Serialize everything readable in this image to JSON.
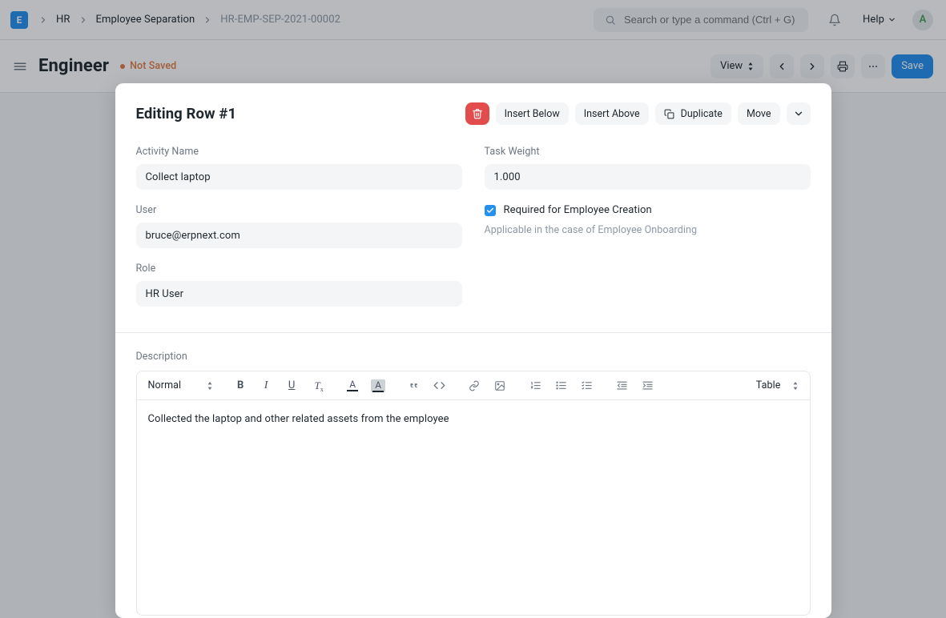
{
  "navbar": {
    "logo_letter": "E",
    "breadcrumbs": [
      "HR",
      "Employee Separation",
      "HR-EMP-SEP-2021-00002"
    ],
    "search_placeholder": "Search or type a command (Ctrl + G)",
    "help_label": "Help",
    "avatar_initial": "A"
  },
  "page": {
    "title": "Engineer",
    "status_label": "Not Saved",
    "toolbar": {
      "view_label": "View",
      "save_label": "Save"
    }
  },
  "modal": {
    "title": "Editing Row #1",
    "buttons": {
      "insert_below": "Insert Below",
      "insert_above": "Insert Above",
      "duplicate": "Duplicate",
      "move": "Move"
    },
    "fields": {
      "activity_name": {
        "label": "Activity Name",
        "value": "Collect laptop"
      },
      "user": {
        "label": "User",
        "value": "bruce@erpnext.com"
      },
      "role": {
        "label": "Role",
        "value": "HR User"
      },
      "task_weight": {
        "label": "Task Weight",
        "value": "1.000"
      },
      "required_for_creation": {
        "label": "Required for Employee Creation",
        "checked": true,
        "help": "Applicable in the case of Employee Onboarding"
      },
      "description": {
        "label": "Description",
        "toolbar": {
          "heading": "Normal",
          "table": "Table"
        },
        "value": "Collected the laptop and other related assets from the employee"
      }
    }
  },
  "icons": {
    "chevron_right": "chevron-right",
    "chevron_left": "chevron-left",
    "chevron_down": "chevron-down",
    "updown": "updown"
  }
}
